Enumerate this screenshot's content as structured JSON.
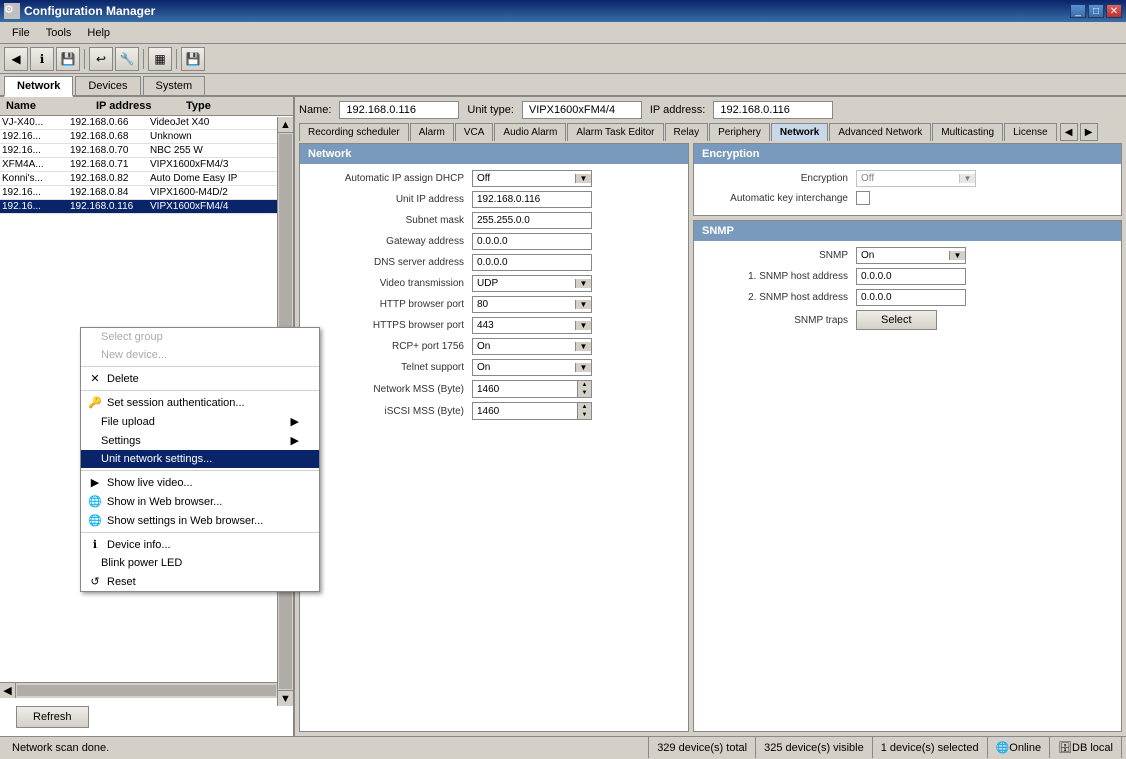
{
  "titleBar": {
    "title": "Configuration Manager",
    "icon": "⚙",
    "controls": [
      "_",
      "□",
      "✕"
    ]
  },
  "menuBar": {
    "items": [
      "File",
      "Tools",
      "Help"
    ]
  },
  "toolbar": {
    "buttons": [
      "🔵",
      "ℹ",
      "💾",
      "↩",
      "🔧",
      "▦",
      "💾"
    ]
  },
  "topTabs": {
    "items": [
      "Network",
      "Devices",
      "System"
    ],
    "active": 0
  },
  "leftPanel": {
    "columns": [
      "Name",
      "IP address",
      "Type"
    ],
    "devices": [
      {
        "name": "VJ-X40...",
        "ip": "192.168.0.66",
        "type": "VideoJet X40"
      },
      {
        "name": "192.16...",
        "ip": "192.168.0.68",
        "type": "Unknown"
      },
      {
        "name": "192.16...",
        "ip": "192.168.0.70",
        "type": "NBC 255 W"
      },
      {
        "name": "XFM4A...",
        "ip": "192.168.0.71",
        "type": "VIPX1600xFM4/3"
      },
      {
        "name": "Konni's...",
        "ip": "192.168.0.82",
        "type": "Auto Dome Easy IP"
      },
      {
        "name": "192.16...",
        "ip": "192.168.0.84",
        "type": "VIPX1600-M4D/2"
      },
      {
        "name": "192.16...",
        "ip": "192.168.0.116",
        "type": "VIPX1600xFM4/4",
        "selected": true
      }
    ],
    "refreshButton": "Refresh"
  },
  "contextMenu": {
    "items": [
      {
        "label": "Select group",
        "disabled": true,
        "hasIcon": false
      },
      {
        "label": "New device...",
        "disabled": true,
        "hasIcon": false
      },
      {
        "label": "Delete",
        "disabled": false,
        "hasIcon": true,
        "icon": "✕"
      },
      {
        "label": "Set session authentication...",
        "disabled": false,
        "hasIcon": true,
        "icon": "🔑"
      },
      {
        "label": "File upload",
        "disabled": false,
        "hasIcon": false,
        "hasArrow": true
      },
      {
        "label": "Settings",
        "disabled": false,
        "hasIcon": false,
        "hasArrow": true
      },
      {
        "label": "Unit network settings...",
        "disabled": false,
        "hasIcon": false,
        "highlighted": true
      },
      {
        "label": "Show live video...",
        "disabled": false,
        "hasIcon": true,
        "icon": "📹"
      },
      {
        "label": "Show in Web browser...",
        "disabled": false,
        "hasIcon": true,
        "icon": "🌐"
      },
      {
        "label": "Show settings in Web browser...",
        "disabled": false,
        "hasIcon": true,
        "icon": "🌐"
      },
      {
        "label": "Device info...",
        "disabled": false,
        "hasIcon": true,
        "icon": "ℹ"
      },
      {
        "label": "Blink power LED",
        "disabled": false,
        "hasIcon": false
      },
      {
        "label": "Reset",
        "disabled": false,
        "hasIcon": true,
        "icon": "↺"
      }
    ]
  },
  "rightPanel": {
    "nameLabel": "Name:",
    "nameValue": "192.168.0.116",
    "unitTypeLabel": "Unit type:",
    "unitTypeValue": "VIPX1600xFM4/4",
    "ipAddressLabel": "IP address:",
    "ipAddressValue": "192.168.0.116",
    "tabs": [
      "Recording scheduler",
      "Alarm",
      "VCA",
      "Audio Alarm",
      "Alarm Task Editor",
      "Relay",
      "Periphery",
      "Network",
      "Advanced Network",
      "Multicasting",
      "License"
    ],
    "activeTab": "Network",
    "networkSection": {
      "title": "Network",
      "fields": [
        {
          "label": "Automatic IP assign DHCP",
          "value": "Off",
          "type": "select"
        },
        {
          "label": "Unit IP address",
          "value": "192.168.0.116",
          "type": "input"
        },
        {
          "label": "Subnet mask",
          "value": "255.255.0.0",
          "type": "input"
        },
        {
          "label": "Gateway address",
          "value": "0.0.0.0",
          "type": "input"
        },
        {
          "label": "DNS server address",
          "value": "0.0.0.0",
          "type": "input"
        },
        {
          "label": "Video transmission",
          "value": "UDP",
          "type": "select"
        },
        {
          "label": "HTTP browser port",
          "value": "80",
          "type": "select"
        },
        {
          "label": "HTTPS browser port",
          "value": "443",
          "type": "select"
        },
        {
          "label": "RCP+ port 1756",
          "value": "On",
          "type": "select"
        },
        {
          "label": "Telnet support",
          "value": "On",
          "type": "select"
        },
        {
          "label": "Network MSS (Byte)",
          "value": "1460",
          "type": "spinner"
        },
        {
          "label": "iSCSI MSS (Byte)",
          "value": "1460",
          "type": "spinner"
        }
      ]
    },
    "encryptionSection": {
      "title": "Encryption",
      "fields": [
        {
          "label": "Encryption",
          "value": "Off",
          "type": "select",
          "disabled": true
        },
        {
          "label": "Automatic key interchange",
          "value": "",
          "type": "checkbox"
        }
      ]
    },
    "snmpSection": {
      "title": "SNMP",
      "fields": [
        {
          "label": "SNMP",
          "value": "On",
          "type": "select"
        },
        {
          "label": "1. SNMP host address",
          "value": "0.0.0.0",
          "type": "input"
        },
        {
          "label": "2. SNMP host address",
          "value": "0.0.0.0",
          "type": "input"
        },
        {
          "label": "SNMP traps",
          "value": "",
          "type": "button",
          "buttonLabel": "Select"
        }
      ]
    }
  },
  "statusBar": {
    "message": "Network scan done.",
    "total": "329 device(s) total",
    "visible": "325 device(s) visible",
    "selected": "1 device(s) selected",
    "online": "Online",
    "db": "DB local"
  }
}
